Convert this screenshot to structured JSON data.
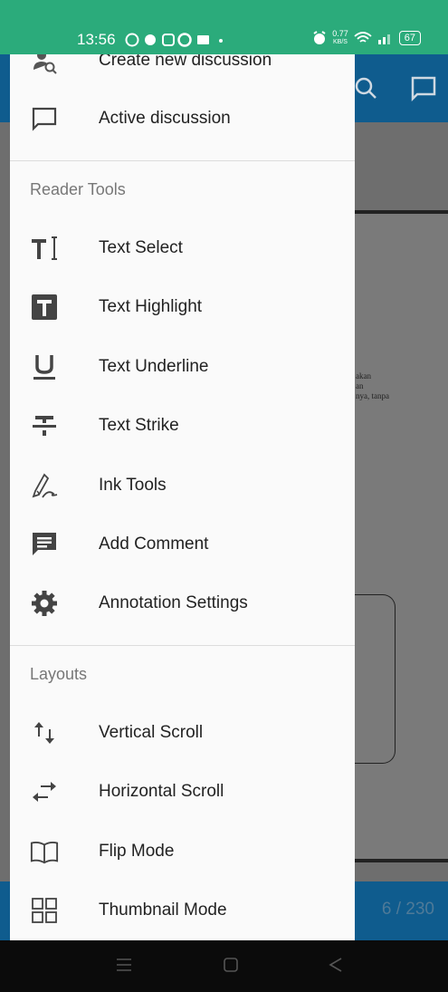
{
  "status_bar": {
    "time": "13:56",
    "net_speed_value": "0.77",
    "net_speed_unit": "KB/S",
    "battery": "67"
  },
  "reader": {
    "page_indicator": "6 / 230",
    "page_text_lines": [
      "akan",
      "an",
      "nya, tanpa"
    ]
  },
  "drawer": {
    "top_items": [
      {
        "label": "Create new discussion",
        "icon": "add-user-icon"
      },
      {
        "label": "Active discussion",
        "icon": "chat-bubble-icon"
      }
    ],
    "reader_tools_title": "Reader Tools",
    "reader_tools": [
      {
        "label": "Text Select",
        "icon": "text-select-icon"
      },
      {
        "label": "Text Highlight",
        "icon": "text-highlight-icon"
      },
      {
        "label": "Text Underline",
        "icon": "text-underline-icon"
      },
      {
        "label": "Text Strike",
        "icon": "text-strike-icon"
      },
      {
        "label": "Ink Tools",
        "icon": "pen-icon"
      },
      {
        "label": "Add Comment",
        "icon": "comment-icon"
      },
      {
        "label": "Annotation Settings",
        "icon": "gear-icon"
      }
    ],
    "layouts_title": "Layouts",
    "layouts": [
      {
        "label": "Vertical Scroll",
        "icon": "vertical-arrows-icon"
      },
      {
        "label": "Horizontal Scroll",
        "icon": "horizontal-arrows-icon"
      },
      {
        "label": "Flip Mode",
        "icon": "book-icon"
      },
      {
        "label": "Thumbnail Mode",
        "icon": "grid-icon"
      }
    ]
  },
  "colors": {
    "status_bar": "#2bab7b",
    "app_bar": "#0f5c8e",
    "drawer_bg": "#fafafa",
    "icon": "#444444"
  }
}
